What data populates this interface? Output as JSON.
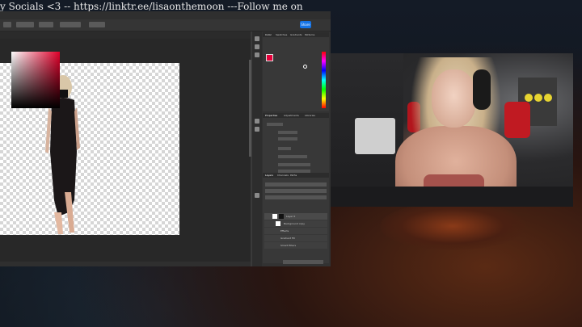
{
  "ticker": {
    "text": "y Socials <3 -- https://linktr.ee/lisaonthemoon ---Follow me on my"
  },
  "photoshop": {
    "share_label": "Share",
    "panels": {
      "color_tabs": [
        "Color",
        "Swatches",
        "Gradients",
        "Patterns"
      ],
      "properties_tabs": [
        "Properties",
        "Adjustments",
        "Libraries"
      ],
      "layers_tabs": [
        "Layers",
        "Channels",
        "Paths"
      ]
    },
    "layers": [
      {
        "name": "Layer 0"
      },
      {
        "name": "Background copy"
      },
      {
        "name": "Effects"
      },
      {
        "name": "Gradient Fill"
      },
      {
        "name": "Smart Filters"
      }
    ]
  },
  "colors": {
    "accent_blue": "#1473e6",
    "foreground_color": "#e5003a",
    "chair_red": "#c01a22"
  }
}
